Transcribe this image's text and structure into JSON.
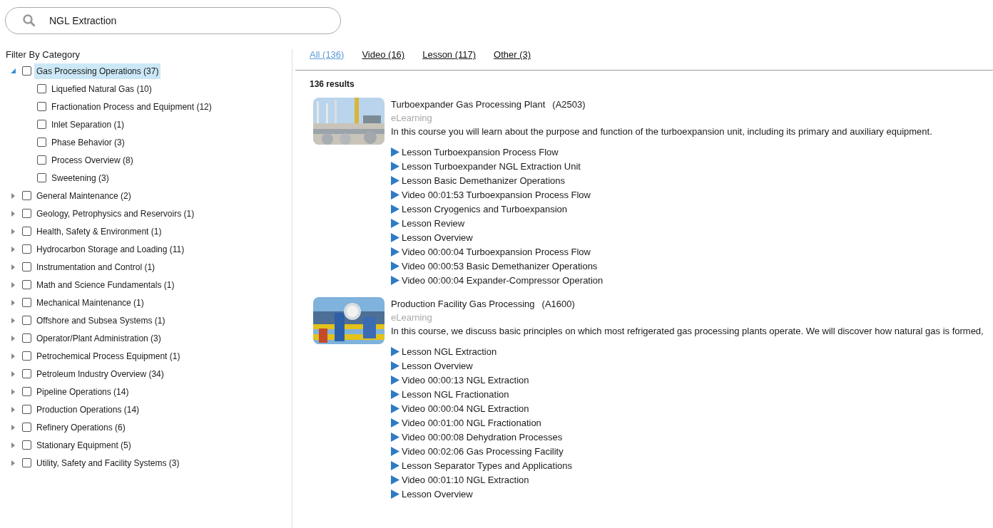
{
  "search": {
    "value": "NGL Extraction"
  },
  "filter": {
    "title": "Filter By Category",
    "categories": [
      {
        "label": "Gas Processing Operations (37)",
        "expanded": true,
        "selected": true,
        "checked": false,
        "children": [
          {
            "label": "Liquefied Natural Gas (10)",
            "checked": false
          },
          {
            "label": "Fractionation Process and Equipment (12)",
            "checked": false
          },
          {
            "label": "Inlet Separation (1)",
            "checked": false
          },
          {
            "label": "Phase Behavior (3)",
            "checked": false
          },
          {
            "label": "Process Overview (8)",
            "checked": false
          },
          {
            "label": "Sweetening (3)",
            "checked": false
          }
        ]
      },
      {
        "label": "General Maintenance (2)",
        "expanded": false,
        "selected": false,
        "checked": false
      },
      {
        "label": "Geology, Petrophysics and Reservoirs (1)",
        "expanded": false,
        "selected": false,
        "checked": false
      },
      {
        "label": "Health, Safety & Environment (1)",
        "expanded": false,
        "selected": false,
        "checked": false
      },
      {
        "label": "Hydrocarbon Storage and Loading (11)",
        "expanded": false,
        "selected": false,
        "checked": false
      },
      {
        "label": "Instrumentation and Control (1)",
        "expanded": false,
        "selected": false,
        "checked": false
      },
      {
        "label": "Math and Science Fundamentals (1)",
        "expanded": false,
        "selected": false,
        "checked": false
      },
      {
        "label": "Mechanical Maintenance (1)",
        "expanded": false,
        "selected": false,
        "checked": false
      },
      {
        "label": "Offshore and Subsea Systems (1)",
        "expanded": false,
        "selected": false,
        "checked": false
      },
      {
        "label": "Operator/Plant Administration (3)",
        "expanded": false,
        "selected": false,
        "checked": false
      },
      {
        "label": "Petrochemical Process Equipment (1)",
        "expanded": false,
        "selected": false,
        "checked": false
      },
      {
        "label": "Petroleum Industry Overview (34)",
        "expanded": false,
        "selected": false,
        "checked": false
      },
      {
        "label": "Pipeline Operations (14)",
        "expanded": false,
        "selected": false,
        "checked": false
      },
      {
        "label": "Production Operations (14)",
        "expanded": false,
        "selected": false,
        "checked": false
      },
      {
        "label": "Refinery Operations (6)",
        "expanded": false,
        "selected": false,
        "checked": false
      },
      {
        "label": "Stationary Equipment (5)",
        "expanded": false,
        "selected": false,
        "checked": false
      },
      {
        "label": "Utility, Safety and Facility Systems (3)",
        "expanded": false,
        "selected": false,
        "checked": false
      }
    ]
  },
  "tabs": [
    {
      "label": "All (136)",
      "selected": true
    },
    {
      "label": "Video (16)",
      "selected": false
    },
    {
      "label": "Lesson (117)",
      "selected": false
    },
    {
      "label": "Other (3)",
      "selected": false
    }
  ],
  "result_count": "136 results",
  "results": [
    {
      "title": "Turboexpander Gas Processing Plant",
      "code": "(A2503)",
      "type": "eLearning",
      "description": "In this course you will learn about the purpose and function of the turboexpansion unit, including its primary and auxiliary equipment.",
      "items": [
        "Lesson Turboexpansion Process Flow",
        "Lesson Turboexpander NGL Extraction Unit",
        "Lesson Basic Demethanizer Operations",
        "Video 00:01:53 Turboexpansion Process Flow",
        "Lesson Cryogenics and Turboexpansion",
        "Lesson Review",
        "Lesson Overview",
        "Video 00:00:04 Turboexpansion Process Flow",
        "Video 00:00:53 Basic Demethanizer Operations",
        "Video 00:00:04 Expander-Compressor Operation"
      ]
    },
    {
      "title": "Production Facility Gas Processing",
      "code": "(A1600)",
      "type": "eLearning",
      "description": "In this course, we discuss basic principles on which most refrigerated gas processing plants operate. We will discover how natural gas is formed,",
      "items": [
        "Lesson NGL Extraction",
        "Lesson Overview",
        "Video 00:00:13 NGL Extraction",
        "Lesson NGL Fractionation",
        "Video 00:00:04 NGL Extraction",
        "Video 00:01:00 NGL Fractionation",
        "Video 00:00:08 Dehydration Processes",
        "Video 00:02:06 Gas Processing Facility",
        "Lesson Separator Types and Applications",
        "Video 00:01:10 NGL Extraction",
        "Lesson Overview"
      ]
    }
  ]
}
